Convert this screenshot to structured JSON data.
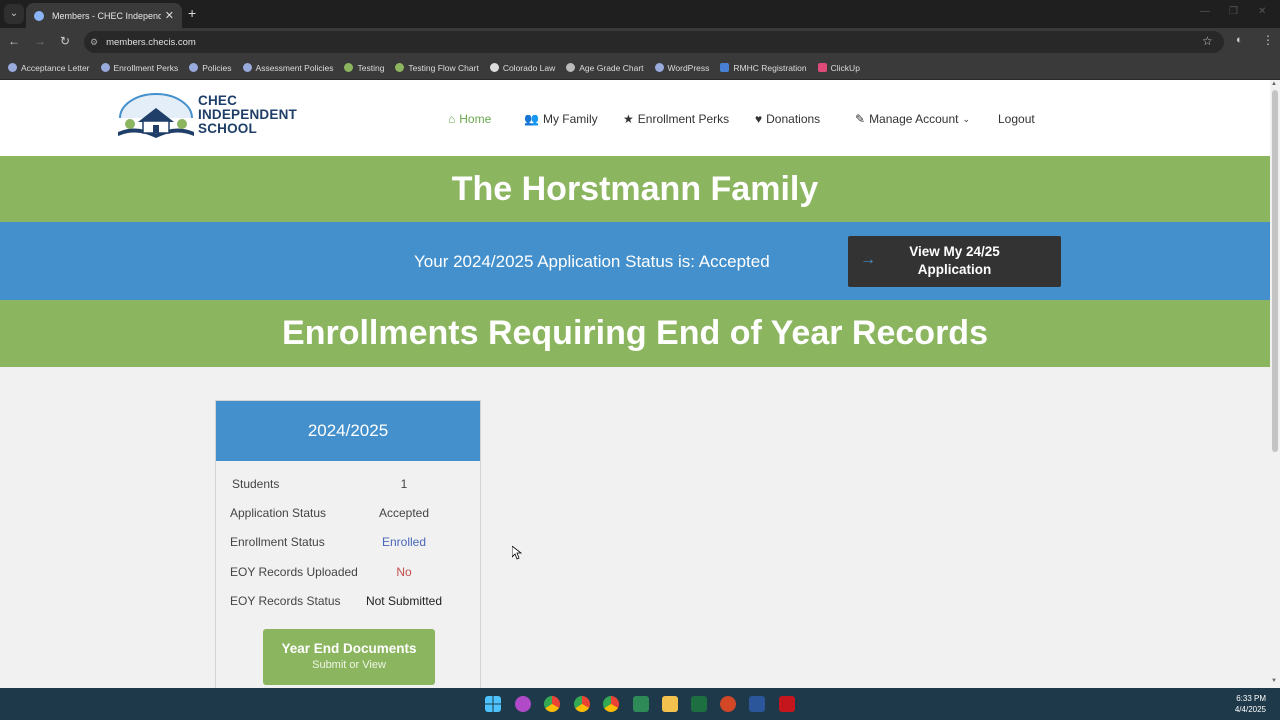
{
  "browser": {
    "tab_title": "Members - CHEC Independent",
    "url": "members.checis.com",
    "bookmarks": [
      "Acceptance Letter",
      "Enrollment Perks",
      "Policies",
      "Assessment Policies",
      "Testing",
      "Testing Flow Chart",
      "Colorado Law",
      "Age Grade Chart",
      "WordPress",
      "RMHC Registration",
      "ClickUp"
    ]
  },
  "header": {
    "logo_line1": "CHEC",
    "logo_line2": "INDEPENDENT",
    "logo_line3": "SCHOOL",
    "nav": {
      "home": "Home",
      "my_family": "My Family",
      "enrollment_perks": "Enrollment Perks",
      "donations": "Donations",
      "manage_account": "Manage Account",
      "logout": "Logout"
    }
  },
  "family_title": "The Horstmann Family",
  "status": {
    "text": "Your 2024/2025 Application Status is: Accepted",
    "button_line1": "View My 24/25",
    "button_line2": "Application"
  },
  "enrollments_heading": "Enrollments Requiring End of Year Records",
  "card": {
    "year": "2024/2025",
    "rows": [
      {
        "label": "Students",
        "value": "1"
      },
      {
        "label": "Application Status",
        "value": "Accepted"
      },
      {
        "label": "Enrollment Status",
        "value": "Enrolled"
      },
      {
        "label": "EOY Records Uploaded",
        "value": "No"
      },
      {
        "label": "EOY Records Status",
        "value": "Not Submitted"
      }
    ],
    "button_title": "Year End Documents",
    "button_subtitle": "Submit or View"
  },
  "taskbar": {
    "time": "6:33 PM",
    "date": "4/4/2025"
  },
  "colors": {
    "green_band": "#8cb560",
    "blue_band": "#4490cc",
    "dark_button": "#333333",
    "nav_active": "#6aa84f"
  }
}
